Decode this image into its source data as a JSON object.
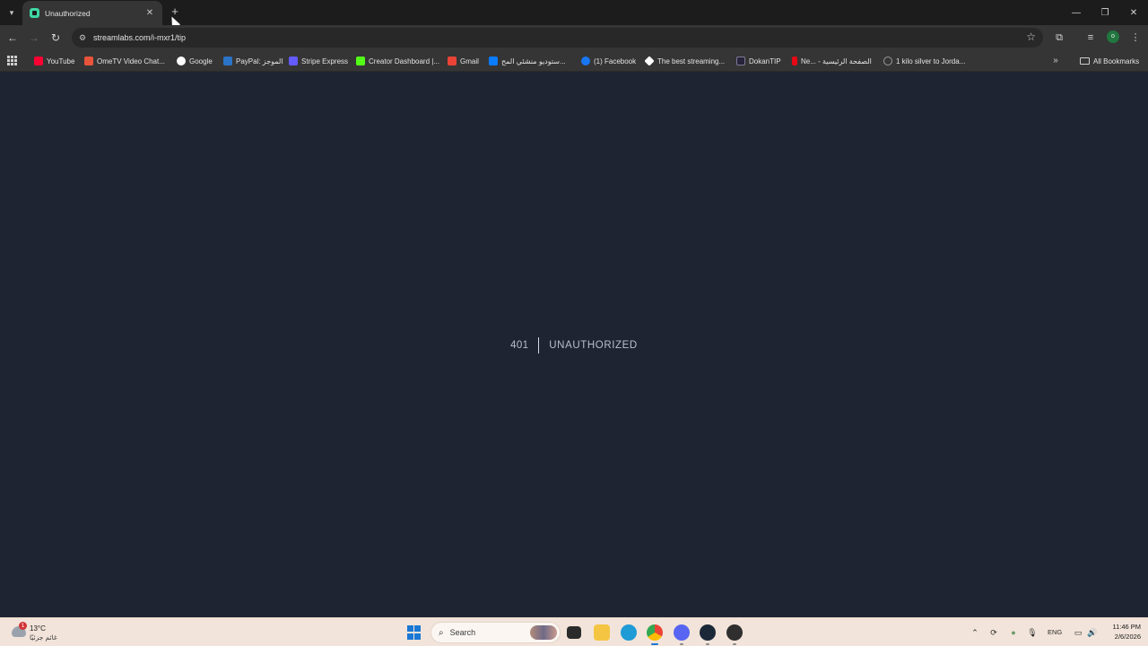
{
  "tab": {
    "title": "Unauthorized",
    "close": "✕",
    "new_tab": "+"
  },
  "window_controls": {
    "minimize": "—",
    "maximize": "❐",
    "close": "✕"
  },
  "toolbar": {
    "back": "←",
    "forward": "→",
    "reload": "↻",
    "url": "streamlabs.com/i-mxr1/tip",
    "star": "☆",
    "extensions": "⧉",
    "media": "≡",
    "menu": "⋮",
    "profile_initial": "o"
  },
  "bookmarks": {
    "items": [
      {
        "label": "YouTube",
        "icon": "youtube-icon",
        "color": "#ff0033"
      },
      {
        "label": "OmeTV Video Chat...",
        "icon": "ometv-icon",
        "color": "#e8543b"
      },
      {
        "label": "Google",
        "icon": "google-icon",
        "color": "#ffffff"
      },
      {
        "label": "PayPal: الموجز",
        "icon": "paypal-icon",
        "color": "#2a73c7"
      },
      {
        "label": "Stripe Express",
        "icon": "stripe-icon",
        "color": "#635bff"
      },
      {
        "label": "Creator Dashboard |...",
        "icon": "kick-icon",
        "color": "#53fc18"
      },
      {
        "label": "Gmail",
        "icon": "gmail-icon",
        "color": "#ea4335"
      },
      {
        "label": "ستوديو منشئي المح...",
        "icon": "meta-icon",
        "color": "#0a7cff"
      },
      {
        "label": "(1) Facebook",
        "icon": "facebook-icon",
        "color": "#1877f2"
      },
      {
        "label": "The best streaming...",
        "icon": "streaming-icon",
        "color": "#ffffff"
      },
      {
        "label": "DokanTIP",
        "icon": "dokantip-icon",
        "color": "#26233a"
      },
      {
        "label": "Ne... - الصفحة الرئيسية",
        "icon": "netflix-icon",
        "color": "#e50914"
      },
      {
        "label": "1 kilo silver to Jorda...",
        "icon": "globe-icon",
        "color": "#9a9a9a"
      }
    ],
    "more": "»",
    "all_bookmarks": "All Bookmarks"
  },
  "error": {
    "code": "401",
    "message": "UNAUTHORIZED"
  },
  "taskbar": {
    "weather_temp": "13°C",
    "weather_desc": "غائم جزئيًا",
    "weather_badge": "1",
    "search_label": "Search",
    "language": "ENG",
    "time": "11:46 PM",
    "date": "2/6/2026",
    "apps": [
      {
        "name": "file-explorer",
        "color": "#f4c542"
      },
      {
        "name": "edge",
        "color": "#1f9bd6"
      },
      {
        "name": "chrome",
        "color": "#e94235"
      },
      {
        "name": "discord",
        "color": "#5865f2"
      },
      {
        "name": "steam",
        "color": "#1b2838"
      },
      {
        "name": "obs",
        "color": "#2f2f2f"
      }
    ]
  }
}
